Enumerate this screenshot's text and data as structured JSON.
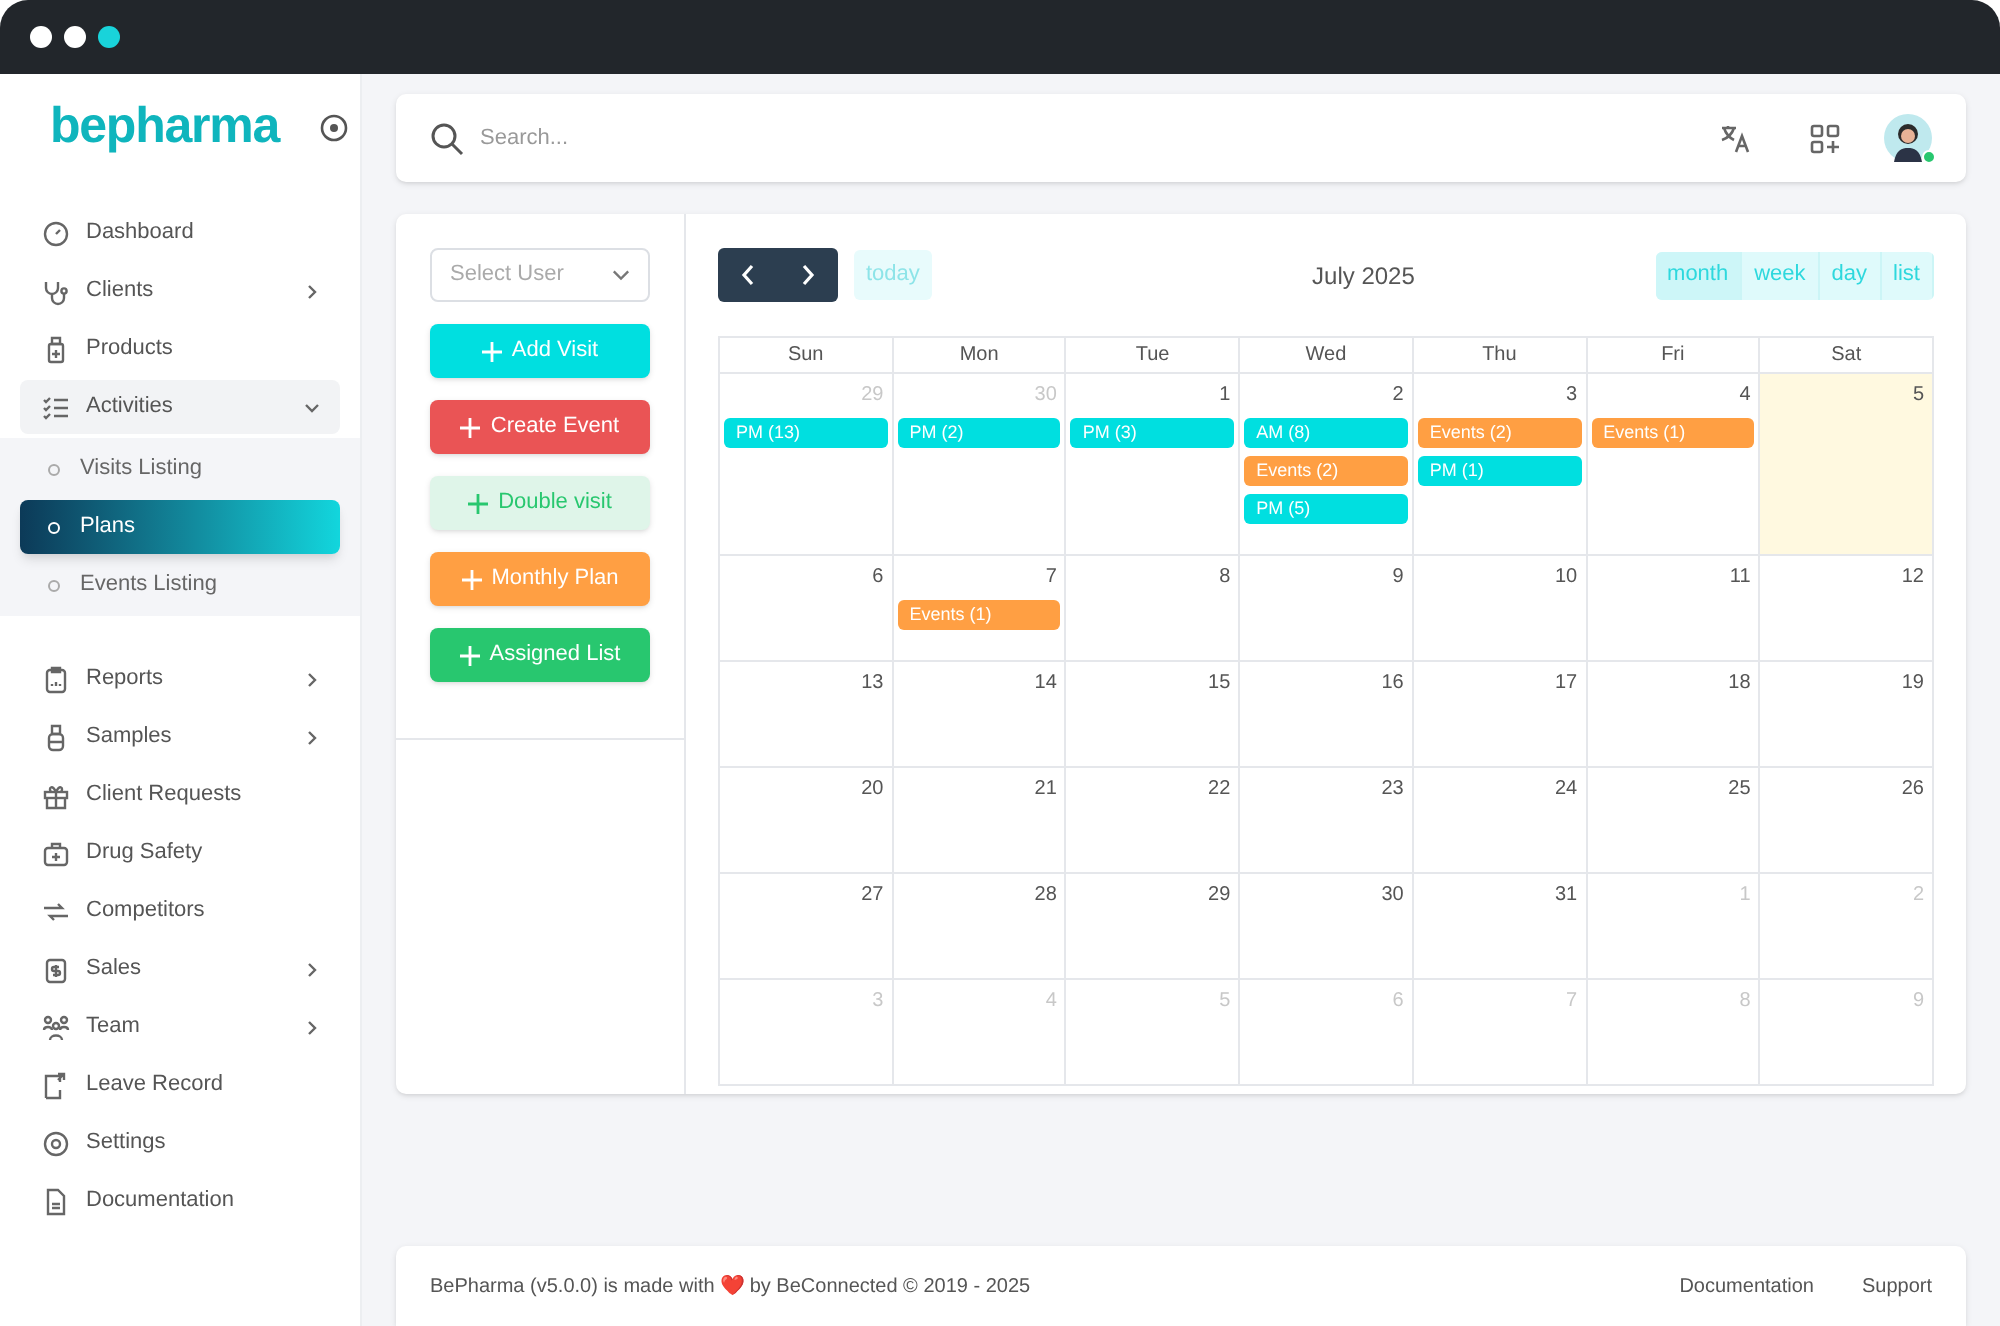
{
  "logo": "bepharma",
  "sidebar": {
    "items": [
      {
        "label": "Dashboard",
        "has_submenu": false
      },
      {
        "label": "Clients",
        "has_submenu": true
      },
      {
        "label": "Products",
        "has_submenu": false
      },
      {
        "label": "Activities",
        "has_submenu": true,
        "expanded": true,
        "children": [
          {
            "label": "Visits Listing",
            "selected": false
          },
          {
            "label": "Plans",
            "selected": true
          },
          {
            "label": "Events Listing",
            "selected": false
          }
        ]
      },
      {
        "label": "Reports",
        "has_submenu": true
      },
      {
        "label": "Samples",
        "has_submenu": true
      },
      {
        "label": "Client Requests",
        "has_submenu": false
      },
      {
        "label": "Drug Safety",
        "has_submenu": false
      },
      {
        "label": "Competitors",
        "has_submenu": false
      },
      {
        "label": "Sales",
        "has_submenu": true
      },
      {
        "label": "Team",
        "has_submenu": true
      },
      {
        "label": "Leave Record",
        "has_submenu": false
      },
      {
        "label": "Settings",
        "has_submenu": false
      },
      {
        "label": "Documentation",
        "has_submenu": false
      }
    ]
  },
  "search": {
    "placeholder": "Search..."
  },
  "user_select": {
    "placeholder": "Select User"
  },
  "actions": [
    {
      "label": "Add Visit",
      "kind": "cyan"
    },
    {
      "label": "Create Event",
      "kind": "red"
    },
    {
      "label": "Double visit",
      "kind": "light"
    },
    {
      "label": "Monthly Plan",
      "kind": "orange"
    },
    {
      "label": "Assigned List",
      "kind": "green"
    }
  ],
  "calendar": {
    "title": "July 2025",
    "today_button": "today",
    "views": [
      {
        "label": "month",
        "selected": true
      },
      {
        "label": "week",
        "selected": false
      },
      {
        "label": "day",
        "selected": false
      },
      {
        "label": "list",
        "selected": false
      }
    ],
    "weekdays": [
      "Sun",
      "Mon",
      "Tue",
      "Wed",
      "Thu",
      "Fri",
      "Sat"
    ],
    "weeks": [
      [
        {
          "day": "29",
          "other_month": true,
          "events": [
            {
              "label": "PM (13)",
              "kind": "visit"
            }
          ]
        },
        {
          "day": "30",
          "other_month": true,
          "events": [
            {
              "label": "PM (2)",
              "kind": "visit"
            }
          ]
        },
        {
          "day": "1",
          "other_month": false,
          "events": [
            {
              "label": "PM (3)",
              "kind": "visit"
            }
          ]
        },
        {
          "day": "2",
          "other_month": false,
          "events": [
            {
              "label": "AM (8)",
              "kind": "visit"
            },
            {
              "label": "Events (2)",
              "kind": "event"
            },
            {
              "label": "PM (5)",
              "kind": "visit"
            }
          ]
        },
        {
          "day": "3",
          "other_month": false,
          "events": [
            {
              "label": "Events (2)",
              "kind": "event"
            },
            {
              "label": "PM (1)",
              "kind": "visit"
            }
          ]
        },
        {
          "day": "4",
          "other_month": false,
          "events": [
            {
              "label": "Events (1)",
              "kind": "event"
            }
          ]
        },
        {
          "day": "5",
          "other_month": false,
          "today": true
        }
      ],
      [
        {
          "day": "6",
          "other_month": false
        },
        {
          "day": "7",
          "other_month": false,
          "events": [
            {
              "label": "Events (1)",
              "kind": "event"
            }
          ]
        },
        {
          "day": "8",
          "other_month": false
        },
        {
          "day": "9",
          "other_month": false
        },
        {
          "day": "10",
          "other_month": false
        },
        {
          "day": "11",
          "other_month": false
        },
        {
          "day": "12",
          "other_month": false
        }
      ],
      [
        {
          "day": "13",
          "other_month": false
        },
        {
          "day": "14",
          "other_month": false
        },
        {
          "day": "15",
          "other_month": false
        },
        {
          "day": "16",
          "other_month": false
        },
        {
          "day": "17",
          "other_month": false
        },
        {
          "day": "18",
          "other_month": false
        },
        {
          "day": "19",
          "other_month": false
        }
      ],
      [
        {
          "day": "20",
          "other_month": false
        },
        {
          "day": "21",
          "other_month": false
        },
        {
          "day": "22",
          "other_month": false
        },
        {
          "day": "23",
          "other_month": false
        },
        {
          "day": "24",
          "other_month": false
        },
        {
          "day": "25",
          "other_month": false
        },
        {
          "day": "26",
          "other_month": false
        }
      ],
      [
        {
          "day": "27",
          "other_month": false
        },
        {
          "day": "28",
          "other_month": false
        },
        {
          "day": "29",
          "other_month": false
        },
        {
          "day": "30",
          "other_month": false
        },
        {
          "day": "31",
          "other_month": false
        },
        {
          "day": "1",
          "other_month": true
        },
        {
          "day": "2",
          "other_month": true
        }
      ],
      [
        {
          "day": "3",
          "other_month": true
        },
        {
          "day": "4",
          "other_month": true
        },
        {
          "day": "5",
          "other_month": true
        },
        {
          "day": "6",
          "other_month": true
        },
        {
          "day": "7",
          "other_month": true
        },
        {
          "day": "8",
          "other_month": true
        },
        {
          "day": "9",
          "other_month": true
        }
      ]
    ]
  },
  "footer": {
    "text": "BePharma (v5.0.0) is made with ❤️ by BeConnected © 2019 - 2025",
    "links": [
      "Documentation",
      "Support"
    ]
  }
}
